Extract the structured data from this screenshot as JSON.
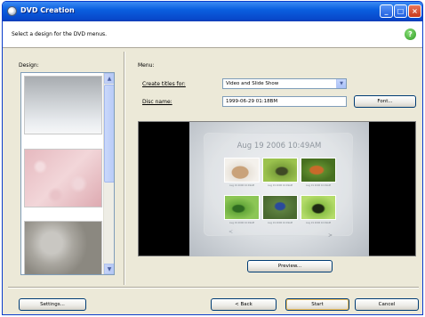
{
  "window": {
    "title": "DVD Creation",
    "instruction": "Select a design for the DVD menus."
  },
  "design": {
    "label": "Design:"
  },
  "menu": {
    "label": "Menu:",
    "create_titles_label": "Create titles for:",
    "create_titles_value": "Video and Slide Show",
    "disc_name_label": "Disc name:",
    "disc_name_value": "1999-06-29 01:18BM",
    "font_button": "Font...",
    "preview_title": "Aug 19 2006 10:49AM",
    "captions": [
      "Aug 19 2006 10:49AM",
      "Aug 19 2006 10:49AM",
      "Aug 19 2006 10:49AM",
      "Aug 19 2006 10:49AM",
      "Aug 19 2006 10:49AM",
      "Aug 19 2006 10:49AM"
    ],
    "prev_arrow": "<",
    "next_arrow": ">",
    "preview_button": "Preview..."
  },
  "footer": {
    "settings_button": "Settings...",
    "back_button": "< Back",
    "start_button": "Start",
    "cancel_button": "Cancel"
  },
  "icons": {
    "app": "dvd-icon",
    "help": "help-icon"
  },
  "colors": {
    "titlebar": "#0a5fe0",
    "help": "#2c9a1f"
  }
}
